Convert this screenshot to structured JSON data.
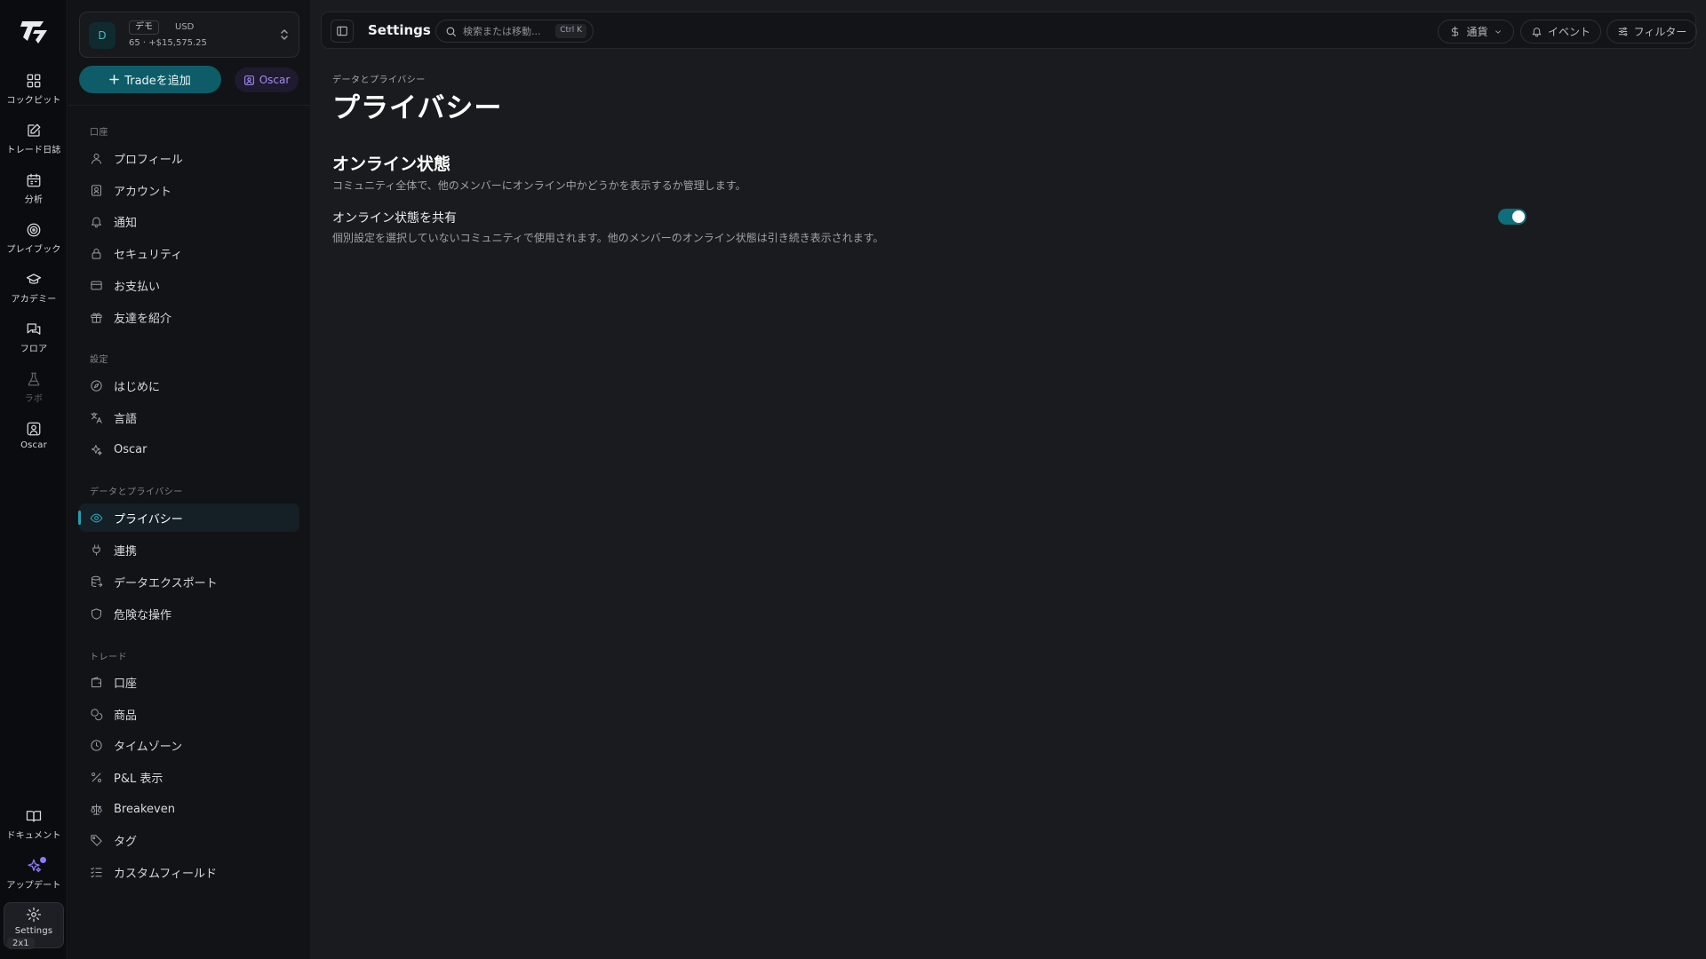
{
  "rail": {
    "items": [
      {
        "label": "コックピット",
        "icon": "dashboard-icon"
      },
      {
        "label": "トレード日誌",
        "icon": "journal-edit-icon"
      },
      {
        "label": "分析",
        "icon": "calendar-icon"
      },
      {
        "label": "プレイブック",
        "icon": "target-icon"
      },
      {
        "label": "アカデミー",
        "icon": "graduation-cap-icon"
      },
      {
        "label": "フロア",
        "icon": "chat-bubbles-icon"
      },
      {
        "label": "ラボ",
        "icon": "flask-icon"
      },
      {
        "label": "Oscar",
        "icon": "oscar-portrait-icon"
      },
      {
        "label": "ドキュメント",
        "icon": "book-icon"
      },
      {
        "label": "アップデート",
        "icon": "sparkles-icon"
      },
      {
        "label": "Settings",
        "icon": "gear-icon"
      }
    ],
    "zoom_badge": "2x1"
  },
  "account": {
    "avatar": "D",
    "tag": "デモ",
    "currency": "USD",
    "summary": "65 · +$15,575.25"
  },
  "buttons": {
    "add_trade": "Tradeを追加",
    "oscar": "Oscar"
  },
  "sidebar": {
    "groups": [
      {
        "label": "口座",
        "items": [
          {
            "label": "プロフィール",
            "icon": "user-icon"
          },
          {
            "label": "アカウント",
            "icon": "id-card-icon"
          },
          {
            "label": "通知",
            "icon": "bell-icon"
          },
          {
            "label": "セキュリティ",
            "icon": "lock-icon"
          },
          {
            "label": "お支払い",
            "icon": "credit-card-icon"
          },
          {
            "label": "友達を紹介",
            "icon": "gift-icon"
          }
        ]
      },
      {
        "label": "設定",
        "items": [
          {
            "label": "はじめに",
            "icon": "compass-icon"
          },
          {
            "label": "言語",
            "icon": "translate-icon"
          },
          {
            "label": "Oscar",
            "icon": "sparkles-icon"
          }
        ]
      },
      {
        "label": "データとプライバシー",
        "items": [
          {
            "label": "プライバシー",
            "icon": "eye-icon",
            "active": true
          },
          {
            "label": "連携",
            "icon": "plug-icon"
          },
          {
            "label": "データエクスポート",
            "icon": "database-export-icon"
          },
          {
            "label": "危険な操作",
            "icon": "shield-icon"
          }
        ]
      },
      {
        "label": "トレード",
        "items": [
          {
            "label": "口座",
            "icon": "wallet-icon"
          },
          {
            "label": "商品",
            "icon": "coins-icon"
          },
          {
            "label": "タイムゾーン",
            "icon": "clock-icon"
          },
          {
            "label": "P&L 表示",
            "icon": "percent-icon"
          },
          {
            "label": "Breakeven",
            "icon": "scale-icon"
          },
          {
            "label": "タグ",
            "icon": "tag-icon"
          },
          {
            "label": "カスタムフィールド",
            "icon": "checklist-icon"
          }
        ]
      }
    ]
  },
  "topbar": {
    "title": "Settings",
    "search_placeholder": "検索または移動...",
    "search_shortcut": "Ctrl K",
    "currency_label": "通貨",
    "events_label": "イベント",
    "filter_label": "フィルター"
  },
  "page": {
    "breadcrumb": "データとプライバシー",
    "title": "プライバシー",
    "section_title": "オンライン状態",
    "section_desc": "コミュニティ全体で、他のメンバーにオンライン中かどうかを表示するか管理します。",
    "setting_label": "オンライン状態を共有",
    "setting_desc": "個別設定を選択していないコミュニティで使用されます。他のメンバーのオンライン状態は引き続き表示されます。",
    "setting_enabled": true
  },
  "colors": {
    "accent": "#0d5c68",
    "toggle_on": "#0e6e7c",
    "oscar_purple": "#a58bf7"
  }
}
